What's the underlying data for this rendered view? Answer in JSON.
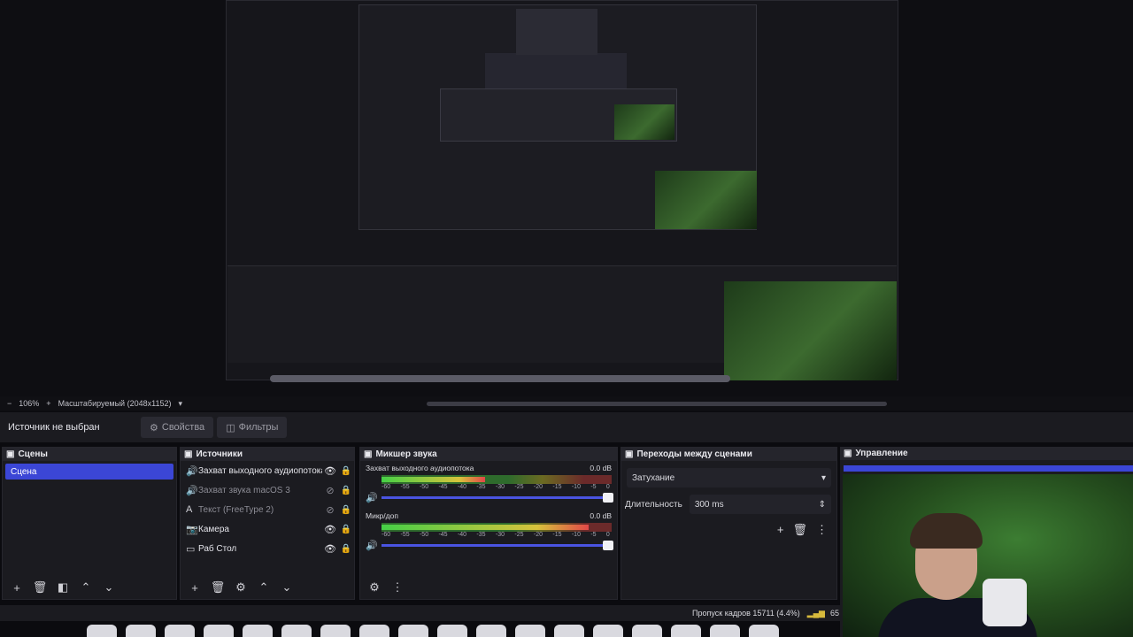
{
  "zoombar": {
    "zoom": "106%",
    "scale": "Масштабируемый (2048x1152)"
  },
  "context": {
    "no_source": "Источник не выбран",
    "properties": "Свойства",
    "filters": "Фильтры"
  },
  "scenes": {
    "title": "Сцены",
    "items": [
      "Сцена"
    ]
  },
  "sources": {
    "title": "Источники",
    "items": [
      {
        "label": "Захват выходного аудиопотока",
        "icon": "speaker-icon"
      },
      {
        "label": "Захват звука macOS 3",
        "icon": "speaker-icon"
      },
      {
        "label": "Текст (FreeType 2)",
        "icon": "text-icon"
      },
      {
        "label": "Камера",
        "icon": "camera-icon"
      },
      {
        "label": "Раб Стол",
        "icon": "monitor-icon"
      }
    ]
  },
  "mixer": {
    "title": "Микшер звука",
    "channels": [
      {
        "name": "Захват выходного аудиопотока",
        "db": "0.0 dB",
        "level": 0.45
      },
      {
        "name": "Микр/доп",
        "db": "0.0 dB",
        "level": 0.9
      }
    ],
    "ticks": [
      "-60",
      "-55",
      "-50",
      "-45",
      "-40",
      "-35",
      "-30",
      "-25",
      "-20",
      "-15",
      "-10",
      "-5",
      "0"
    ]
  },
  "transitions": {
    "title": "Переходы между сценами",
    "selected": "Затухание",
    "duration_label": "Длительность",
    "duration": "300 ms"
  },
  "controls": {
    "title": "Управление"
  },
  "status": {
    "dropped": "Пропуск кадров 15711 (4.4%)",
    "extra": "65"
  },
  "colors": {
    "accent": "#3b46d6",
    "panel": "#1b1b20"
  }
}
